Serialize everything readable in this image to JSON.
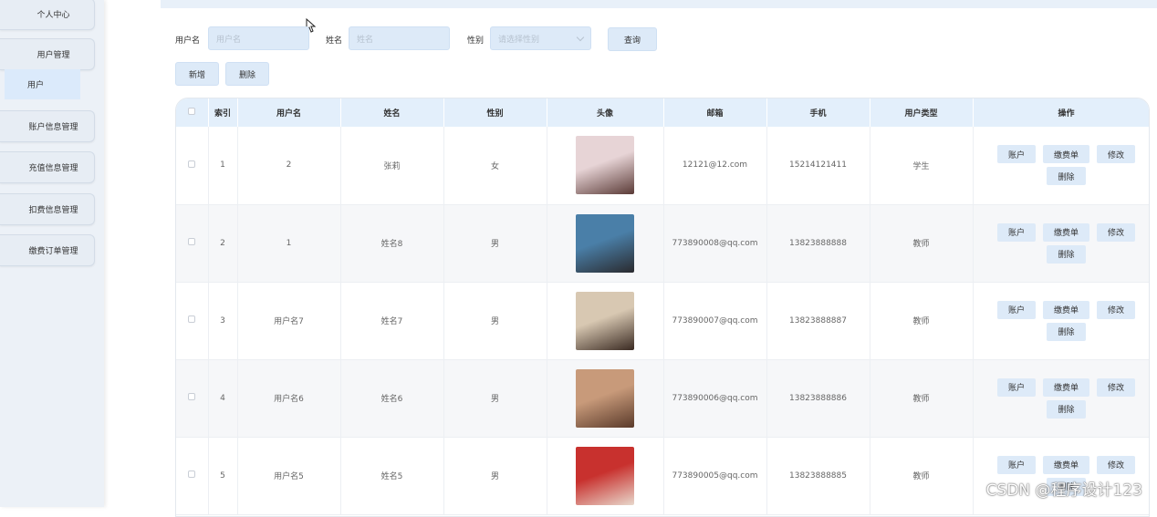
{
  "sidebar": {
    "items": [
      {
        "label": "个人中心"
      },
      {
        "label": "用户管理"
      },
      {
        "label": "账户信息管理"
      },
      {
        "label": "充值信息管理"
      },
      {
        "label": "扣费信息管理"
      },
      {
        "label": "缴费订单管理"
      }
    ],
    "sub_item": "用户"
  },
  "search": {
    "username_label": "用户名",
    "username_placeholder": "用户名",
    "name_label": "姓名",
    "name_placeholder": "姓名",
    "gender_label": "性别",
    "gender_placeholder": "请选择性别",
    "query_button": "查询"
  },
  "toolbar": {
    "add_button": "新增",
    "delete_button": "删除"
  },
  "table": {
    "columns": [
      "索引",
      "用户名",
      "姓名",
      "性别",
      "头像",
      "邮箱",
      "手机",
      "用户类型",
      "操作"
    ],
    "rows": [
      {
        "index": "1",
        "username": "2",
        "name": "张莉",
        "gender": "女",
        "email": "12121@12.com",
        "phone": "15214121411",
        "type": "学生",
        "avatar_colors": [
          "#e7d4d6",
          "#5a3a36"
        ]
      },
      {
        "index": "2",
        "username": "1",
        "name": "姓名8",
        "gender": "男",
        "email": "773890008@qq.com",
        "phone": "13823888888",
        "type": "教师",
        "avatar_colors": [
          "#4a7fa8",
          "#2a2a2e"
        ]
      },
      {
        "index": "3",
        "username": "用户名7",
        "name": "姓名7",
        "gender": "男",
        "email": "773890007@qq.com",
        "phone": "13823888887",
        "type": "教师",
        "avatar_colors": [
          "#d8c8b2",
          "#3a2a22"
        ]
      },
      {
        "index": "4",
        "username": "用户名6",
        "name": "姓名6",
        "gender": "男",
        "email": "773890006@qq.com",
        "phone": "13823888886",
        "type": "教师",
        "avatar_colors": [
          "#c89a7a",
          "#5a3a2a"
        ]
      },
      {
        "index": "5",
        "username": "用户名5",
        "name": "姓名5",
        "gender": "男",
        "email": "773890005@qq.com",
        "phone": "13823888885",
        "type": "教师",
        "avatar_colors": [
          "#c8312e",
          "#e8d8cc"
        ]
      }
    ],
    "row_actions": {
      "account": "账户",
      "bill": "缴费单",
      "edit": "修改",
      "delete": "删除"
    }
  },
  "watermark": "CSDN @程序设计123"
}
